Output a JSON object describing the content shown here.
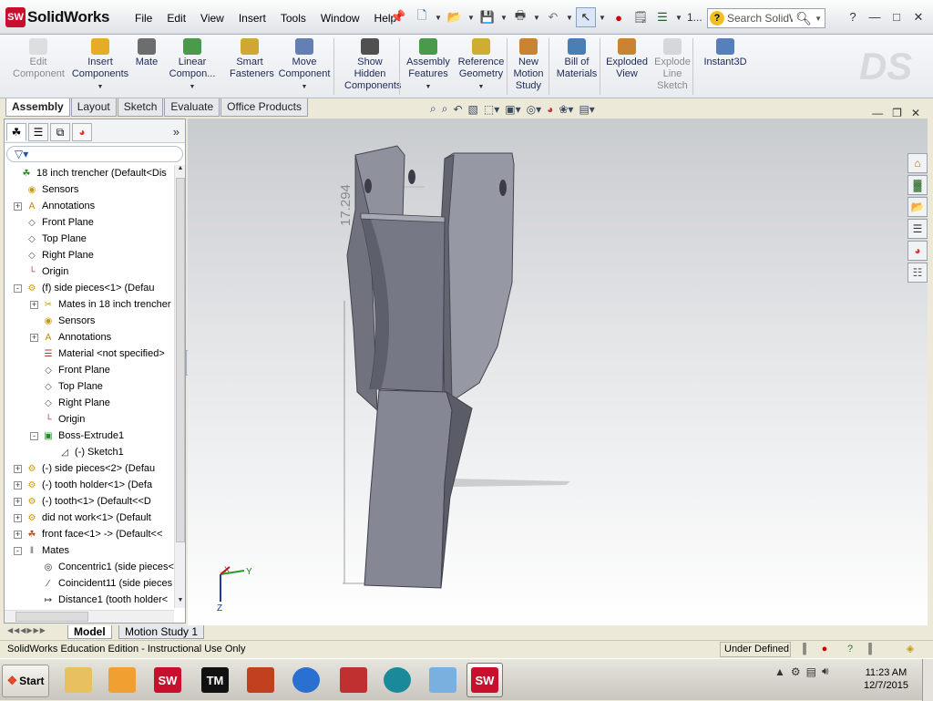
{
  "app": {
    "brand": "SolidWorks",
    "brand_mark": "SW"
  },
  "menu": [
    "File",
    "Edit",
    "View",
    "Insert",
    "Tools",
    "Window",
    "Help"
  ],
  "quick_access": {
    "ellipsis": "1..."
  },
  "search": {
    "placeholder": "Search SolidWo"
  },
  "command_manager": [
    {
      "label": "Edit\nComponent",
      "icon": "edit-component-icon",
      "enabled": false
    },
    {
      "label": "Insert\nComponents",
      "icon": "insert-components-icon",
      "enabled": true,
      "dropdown": true
    },
    {
      "label": "Mate",
      "icon": "mate-icon",
      "enabled": true
    },
    {
      "label": "Linear\nCompon...",
      "icon": "linear-pattern-icon",
      "enabled": true,
      "dropdown": true
    },
    {
      "label": "Smart\nFasteners",
      "icon": "smart-fasteners-icon",
      "enabled": true
    },
    {
      "label": "Move\nComponent",
      "icon": "move-component-icon",
      "enabled": true,
      "dropdown": true
    },
    {
      "label": "Show\nHidden\nComponents",
      "icon": "show-hidden-icon",
      "enabled": true
    },
    {
      "label": "Assembly\nFeatures",
      "icon": "assembly-features-icon",
      "enabled": true,
      "dropdown": true
    },
    {
      "label": "Reference\nGeometry",
      "icon": "reference-geometry-icon",
      "enabled": true,
      "dropdown": true
    },
    {
      "label": "New\nMotion\nStudy",
      "icon": "motion-study-icon",
      "enabled": true
    },
    {
      "label": "Bill of\nMaterials",
      "icon": "bom-icon",
      "enabled": true
    },
    {
      "label": "Exploded\nView",
      "icon": "exploded-view-icon",
      "enabled": true
    },
    {
      "label": "Explode\nLine\nSketch",
      "icon": "explode-line-icon",
      "enabled": false
    },
    {
      "label": "Instant3D",
      "icon": "instant3d-icon",
      "enabled": true
    }
  ],
  "tabs": [
    "Assembly",
    "Layout",
    "Sketch",
    "Evaluate",
    "Office Products"
  ],
  "active_tab": "Assembly",
  "tree": [
    {
      "label": "18 inch trencher  (Default<Dis",
      "level": 0,
      "toggle": "",
      "icon": "assembly-icon"
    },
    {
      "label": "Sensors",
      "level": 1,
      "toggle": "",
      "icon": "sensors-icon"
    },
    {
      "label": "Annotations",
      "level": 1,
      "toggle": "+",
      "icon": "annotations-icon"
    },
    {
      "label": "Front Plane",
      "level": 1,
      "toggle": "",
      "icon": "plane-icon"
    },
    {
      "label": "Top Plane",
      "level": 1,
      "toggle": "",
      "icon": "plane-icon"
    },
    {
      "label": "Right Plane",
      "level": 1,
      "toggle": "",
      "icon": "plane-icon"
    },
    {
      "label": "Origin",
      "level": 1,
      "toggle": "",
      "icon": "origin-icon"
    },
    {
      "label": "(f) side pieces<1> (Defau",
      "level": 1,
      "toggle": "-",
      "icon": "part-icon"
    },
    {
      "label": "Mates in 18 inch trencher",
      "level": 2,
      "toggle": "+",
      "icon": "mates-folder-icon"
    },
    {
      "label": "Sensors",
      "level": 2,
      "toggle": "",
      "icon": "sensors-icon"
    },
    {
      "label": "Annotations",
      "level": 2,
      "toggle": "+",
      "icon": "annotations-icon"
    },
    {
      "label": "Material <not specified>",
      "level": 2,
      "toggle": "",
      "icon": "material-icon"
    },
    {
      "label": "Front Plane",
      "level": 2,
      "toggle": "",
      "icon": "plane-icon"
    },
    {
      "label": "Top Plane",
      "level": 2,
      "toggle": "",
      "icon": "plane-icon"
    },
    {
      "label": "Right Plane",
      "level": 2,
      "toggle": "",
      "icon": "plane-icon"
    },
    {
      "label": "Origin",
      "level": 2,
      "toggle": "",
      "icon": "origin-icon"
    },
    {
      "label": "Boss-Extrude1",
      "level": 2,
      "toggle": "-",
      "icon": "extrude-icon"
    },
    {
      "label": "(-) Sketch1",
      "level": 3,
      "toggle": "",
      "icon": "sketch-icon"
    },
    {
      "label": "(-) side pieces<2> (Defau",
      "level": 1,
      "toggle": "+",
      "icon": "part-icon"
    },
    {
      "label": "(-) tooth holder<1> (Defa",
      "level": 1,
      "toggle": "+",
      "icon": "part-icon"
    },
    {
      "label": "(-) tooth<1> (Default<<D",
      "level": 1,
      "toggle": "+",
      "icon": "part-icon"
    },
    {
      "label": "did not work<1> (Default",
      "level": 1,
      "toggle": "+",
      "icon": "part-icon"
    },
    {
      "label": "front face<1> -> (Default<<",
      "level": 1,
      "toggle": "+",
      "icon": "subassembly-icon"
    },
    {
      "label": "Mates",
      "level": 1,
      "toggle": "-",
      "icon": "mates-icon"
    },
    {
      "label": "Concentric1 (side pieces<",
      "level": 2,
      "toggle": "",
      "icon": "concentric-icon"
    },
    {
      "label": "Coincident11 (side pieces",
      "level": 2,
      "toggle": "",
      "icon": "coincident-icon"
    },
    {
      "label": "Distance1 (tooth holder<",
      "level": 2,
      "toggle": "",
      "icon": "distance-icon"
    }
  ],
  "viewport": {
    "dimension": "17.294",
    "triad": {
      "x": "X",
      "y": "Y",
      "z": "Z"
    }
  },
  "bottom_tabs": [
    "Model",
    "Motion Study 1"
  ],
  "status": {
    "message": "SolidWorks Education Edition - Instructional Use Only",
    "state": "Under Defined"
  },
  "taskbar": {
    "start": "Start",
    "apps": [
      {
        "icon": "explorer-icon",
        "text": ""
      },
      {
        "icon": "media-player-icon",
        "text": ""
      },
      {
        "icon": "solidworks-icon",
        "text": "SW"
      },
      {
        "icon": "tm-icon",
        "text": "TM"
      },
      {
        "icon": "feather-icon",
        "text": ""
      },
      {
        "icon": "chrome-icon",
        "text": ""
      },
      {
        "icon": "red-v-icon",
        "text": ""
      },
      {
        "icon": "arduino-icon",
        "text": ""
      },
      {
        "icon": "weather-icon",
        "text": ""
      },
      {
        "icon": "solidworks-active-icon",
        "text": "SW"
      }
    ],
    "time": "11:23 AM",
    "date": "12/7/2015"
  },
  "colors": {
    "brand_red": "#c8102e",
    "part_gray": "#7d7f8c",
    "accent_blue": "#1a58b5"
  }
}
